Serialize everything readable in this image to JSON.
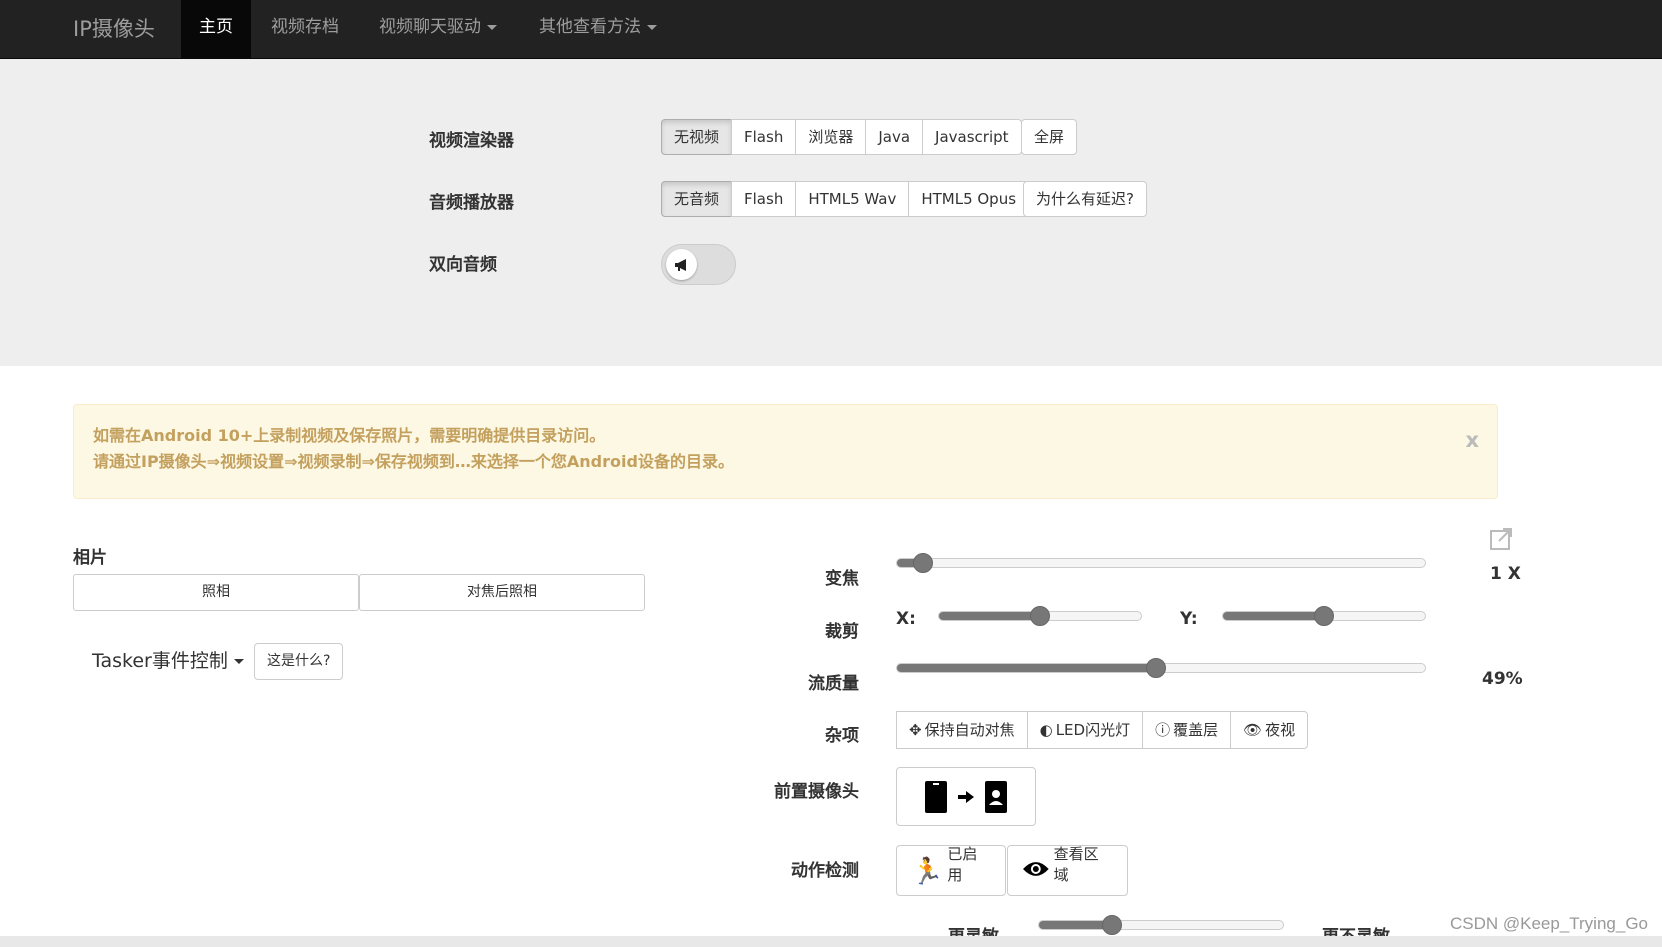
{
  "navbar": {
    "brand": "IP摄像头",
    "items": [
      {
        "label": "主页",
        "active": true
      },
      {
        "label": "视频存档"
      },
      {
        "label": "视频聊天驱动",
        "dropdown": true
      },
      {
        "label": "其他查看方法",
        "dropdown": true
      }
    ]
  },
  "renderer": {
    "label": "视频渲染器",
    "options": [
      "无视频",
      "Flash",
      "浏览器",
      "Java",
      "Javascript"
    ],
    "selected": "无视频",
    "fullscreen": "全屏"
  },
  "audio": {
    "label": "音频播放器",
    "options": [
      "无音频",
      "Flash",
      "HTML5 Wav",
      "HTML5 Opus"
    ],
    "selected": "无音频",
    "why_delay": "为什么有延迟?"
  },
  "twoway": {
    "label": "双向音频",
    "icon": "megaphone-icon",
    "enabled": false
  },
  "alert": {
    "line1": "如需在Android 10+上录制视频及保存照片，需要明确提供目录访问。",
    "line2": "请通过IP摄像头⇒视频设置⇒视频录制⇒保存视频到…来选择一个您Android设备的目录。",
    "close": "x",
    "color": "#c4a05e"
  },
  "photo": {
    "title": "相片",
    "take_photo": "照相",
    "focus_photo": "对焦后照相"
  },
  "tasker": {
    "label": "Tasker事件控制",
    "help": "这是什么?"
  },
  "controls": {
    "zoom": {
      "label": "变焦",
      "value": 0.05,
      "display": "1 X"
    },
    "crop": {
      "label": "裁剪",
      "x_label": "X:",
      "x_value": 0.5,
      "y_label": "Y:",
      "y_value": 0.5
    },
    "quality": {
      "label": "流质量",
      "value": 0.49,
      "display": "49%"
    },
    "misc": {
      "label": "杂项",
      "buttons": [
        {
          "icon": "crosshair-icon",
          "label": "保持自动对焦"
        },
        {
          "icon": "contrast-icon",
          "label": "LED闪光灯"
        },
        {
          "icon": "info-icon",
          "label": "覆盖层"
        },
        {
          "icon": "eye-icon",
          "label": "夜视"
        }
      ]
    },
    "front_camera": {
      "label": "前置摄像头"
    },
    "motion": {
      "label": "动作检测",
      "enabled_label": "已启用",
      "view_area_label": "查看区域",
      "sensitivity_left": "更灵敏",
      "sensitivity_right": "更不灵敏",
      "sensitivity_value": 0.3
    }
  },
  "watermark": "CSDN @Keep_Trying_Go"
}
